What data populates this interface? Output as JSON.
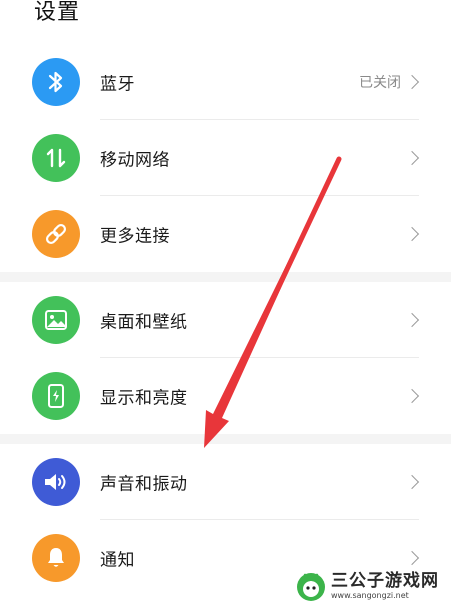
{
  "header": {
    "title": "设置"
  },
  "groups": [
    {
      "items": [
        {
          "label": "蓝牙",
          "status": "已关闭",
          "icon": "bluetooth-icon",
          "color": "#2b9af3"
        },
        {
          "label": "移动网络",
          "status": "",
          "icon": "mobile-data-icon",
          "color": "#43c15a"
        },
        {
          "label": "更多连接",
          "status": "",
          "icon": "link-icon",
          "color": "#f7992b"
        }
      ]
    },
    {
      "items": [
        {
          "label": "桌面和壁纸",
          "status": "",
          "icon": "image-icon",
          "color": "#43c15a"
        },
        {
          "label": "显示和亮度",
          "status": "",
          "icon": "phone-brightness-icon",
          "color": "#43c15a"
        }
      ]
    },
    {
      "items": [
        {
          "label": "声音和振动",
          "status": "",
          "icon": "speaker-icon",
          "color": "#3f5bd6"
        },
        {
          "label": "通知",
          "status": "",
          "icon": "bell-icon",
          "color": "#f7992b"
        }
      ]
    }
  ],
  "annotation": {
    "arrow_color": "#e8363a"
  },
  "watermark": {
    "title": "三公子游戏网",
    "url": "www.sangongzi.net"
  }
}
